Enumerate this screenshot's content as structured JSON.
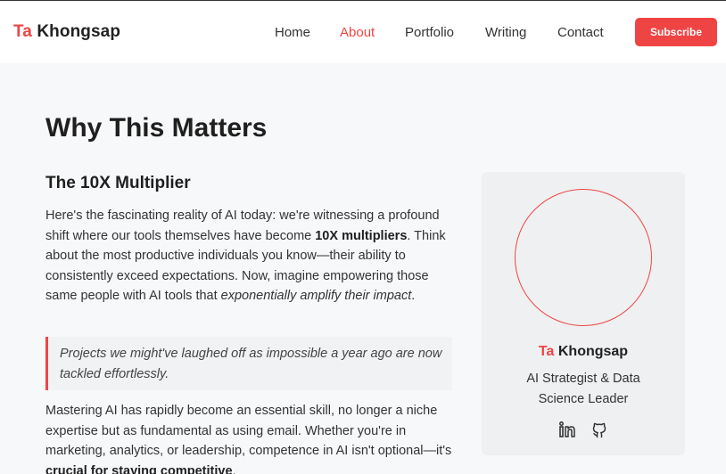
{
  "brand": {
    "first": "Ta",
    "last": "Khongsap"
  },
  "nav": {
    "items": [
      {
        "label": "Home",
        "active": false
      },
      {
        "label": "About",
        "active": true
      },
      {
        "label": "Portfolio",
        "active": false
      },
      {
        "label": "Writing",
        "active": false
      },
      {
        "label": "Contact",
        "active": false
      }
    ],
    "subscribe_label": "Subscribe"
  },
  "main": {
    "title": "Why This Matters",
    "section_title": "The 10X Multiplier",
    "p1": {
      "a": "Here's the fascinating reality of AI today: we're witnessing a profound shift where our tools themselves have become ",
      "b": "10X multipliers",
      "c": ". Think about the most productive individuals you know—their ability to consistently exceed expectations. Now, imagine empowering those same people with AI tools that ",
      "d": "exponentially amplify their impact",
      "e": "."
    },
    "quote": "Projects we might've laughed off as impossible a year ago are now tackled effortlessly.",
    "p2": {
      "a": "Mastering AI has rapidly become an essential skill, no longer a niche expertise but as fundamental as using email. Whether you're in marketing, analytics, or leadership, competence in AI isn't optional—it's ",
      "b": "crucial for staying competitive",
      "c": "."
    }
  },
  "profile": {
    "name_first": "Ta",
    "name_last": "Khongsap",
    "role": "AI Strategist & Data Science Leader",
    "socials": [
      {
        "icon": "linkedin-icon"
      },
      {
        "icon": "github-icon"
      }
    ]
  },
  "colors": {
    "accent": "#ef4444",
    "header_bg": "#ffffff",
    "page_bg": "#f7f8fa",
    "card_bg": "#eff0f2"
  }
}
